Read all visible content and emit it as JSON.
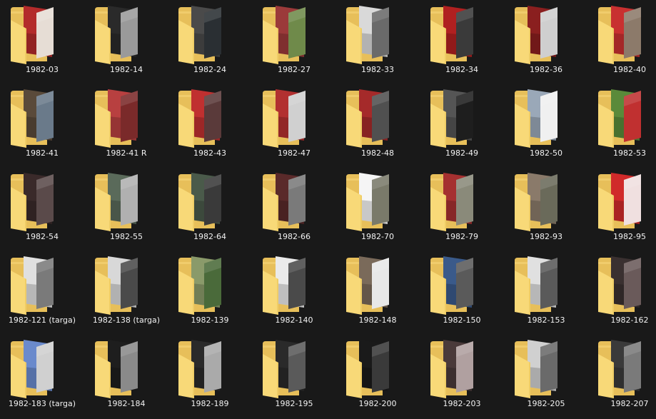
{
  "folders": [
    {
      "name": "1982-03",
      "thumbs": [
        "#b32b2b",
        "#e6ddd5"
      ]
    },
    {
      "name": "1982-14",
      "thumbs": [
        "#2a2a2a",
        "#9a9a9a"
      ]
    },
    {
      "name": "1982-24",
      "thumbs": [
        "#4a4a4a",
        "#2a2f33"
      ]
    },
    {
      "name": "1982-27",
      "thumbs": [
        "#9b3a3a",
        "#6f8a4a"
      ]
    },
    {
      "name": "1982-33",
      "thumbs": [
        "#d9d9d9",
        "#6a6a6a"
      ]
    },
    {
      "name": "1982-34",
      "thumbs": [
        "#b02020",
        "#3a3a3a"
      ]
    },
    {
      "name": "1982-36",
      "thumbs": [
        "#8a1f1f",
        "#cfcfcf"
      ]
    },
    {
      "name": "1982-40",
      "thumbs": [
        "#c83030",
        "#8c7a6a"
      ]
    },
    {
      "name": "1982-41",
      "thumbs": [
        "#5a4a3a",
        "#6a7a8a"
      ]
    },
    {
      "name": "1982-41 R",
      "thumbs": [
        "#b84040",
        "#7a2a2a"
      ]
    },
    {
      "name": "1982-43",
      "thumbs": [
        "#c03030",
        "#5a3a3a"
      ]
    },
    {
      "name": "1982-47",
      "thumbs": [
        "#b23030",
        "#d0d0d0"
      ]
    },
    {
      "name": "1982-48",
      "thumbs": [
        "#a52a2a",
        "#505050"
      ]
    },
    {
      "name": "1982-49",
      "thumbs": [
        "#555555",
        "#1e1e1e"
      ]
    },
    {
      "name": "1982-50",
      "thumbs": [
        "#9aa8b8",
        "#f0f0f0"
      ]
    },
    {
      "name": "1982-53",
      "thumbs": [
        "#5a8a3a",
        "#c03030"
      ]
    },
    {
      "name": "1982-54",
      "thumbs": [
        "#3a2a2a",
        "#5a4a4a"
      ]
    },
    {
      "name": "1982-55",
      "thumbs": [
        "#5a6a5a",
        "#b0b0b0"
      ]
    },
    {
      "name": "1982-64",
      "thumbs": [
        "#4a5a4a",
        "#3a3a3a"
      ]
    },
    {
      "name": "1982-66",
      "thumbs": [
        "#5a2a2a",
        "#7a7a7a"
      ]
    },
    {
      "name": "1982-70",
      "thumbs": [
        "#f5f5f5",
        "#7a7a6a"
      ]
    },
    {
      "name": "1982-79",
      "thumbs": [
        "#a53030",
        "#8a8a7a"
      ]
    },
    {
      "name": "1982-93",
      "thumbs": [
        "#8a7a6a",
        "#6a6a5a"
      ]
    },
    {
      "name": "1982-95",
      "thumbs": [
        "#d02a2a",
        "#f0e0e0"
      ]
    },
    {
      "name": "1982-121 (targa)",
      "thumbs": [
        "#e0e0e0",
        "#7a7a7a"
      ]
    },
    {
      "name": "1982-138 (targa)",
      "thumbs": [
        "#d8d8d8",
        "#4a4a4a"
      ]
    },
    {
      "name": "1982-139",
      "thumbs": [
        "#8a9a6a",
        "#4a6a3a"
      ]
    },
    {
      "name": "1982-140",
      "thumbs": [
        "#eaeaea",
        "#4a4a4a"
      ]
    },
    {
      "name": "1982-148",
      "thumbs": [
        "#7a6a5a",
        "#e8e8e8"
      ]
    },
    {
      "name": "1982-150",
      "thumbs": [
        "#3a5a8a",
        "#5a5a5a"
      ]
    },
    {
      "name": "1982-153",
      "thumbs": [
        "#e0e0e0",
        "#5a5a5a"
      ]
    },
    {
      "name": "1982-162",
      "thumbs": [
        "#3a3030",
        "#6a5a5a"
      ]
    },
    {
      "name": "1982-183 (targa)",
      "thumbs": [
        "#6a8acc",
        "#d0d0d0"
      ]
    },
    {
      "name": "1982-184",
      "thumbs": [
        "#1e1e1e",
        "#8a8a8a"
      ]
    },
    {
      "name": "1982-189",
      "thumbs": [
        "#2a2a2a",
        "#aaaaaa"
      ]
    },
    {
      "name": "1982-195",
      "thumbs": [
        "#2a2a2a",
        "#5a5a5a"
      ]
    },
    {
      "name": "1982-200",
      "thumbs": [
        "#1a1a1a",
        "#3a3a3a"
      ]
    },
    {
      "name": "1982-203",
      "thumbs": [
        "#4a3a3a",
        "#b0a0a0"
      ]
    },
    {
      "name": "1982-205",
      "thumbs": [
        "#d0d0d0",
        "#6a6a6a"
      ]
    },
    {
      "name": "1982-207",
      "thumbs": [
        "#3a3a3a",
        "#7a7a7a"
      ]
    }
  ],
  "colors": {
    "background": "#191919",
    "folder_back": "#e7bf5a",
    "folder_back_top": "#f0cc6c",
    "folder_front": "#f8d978",
    "folder_front_dark": "#efcd66",
    "label_text": "#f2f2f2"
  }
}
